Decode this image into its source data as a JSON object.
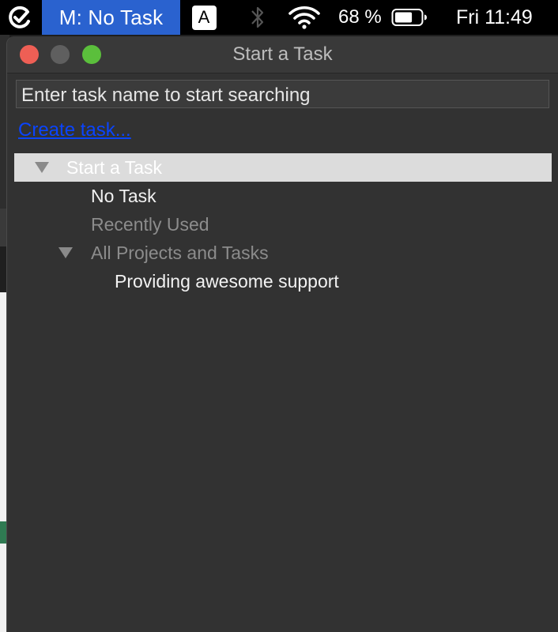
{
  "menubar": {
    "task_label": "M: No Task",
    "input_source": "A",
    "battery_percent": "68 %",
    "battery_level": 0.68,
    "clock": "Fri 11:49"
  },
  "window": {
    "title": "Start a Task",
    "search": {
      "value": "",
      "placeholder": "Enter task name to start searching"
    },
    "create_link": "Create task...",
    "tree": [
      {
        "label": "Start a Task",
        "expanded": true,
        "selected": true
      },
      {
        "label": "No Task"
      },
      {
        "label": "Recently Used"
      },
      {
        "label": "All Projects and Tasks",
        "expanded": true
      },
      {
        "label": "Providing awesome support"
      }
    ]
  },
  "colors": {
    "menubar_highlight": "#2a62cf",
    "link": "#0a44ff",
    "selection": "#dcdcdc",
    "close": "#ee5f55",
    "zoom": "#5bbf3c"
  },
  "icons": [
    "app-check-icon",
    "bluetooth-icon",
    "wifi-icon",
    "battery-icon",
    "disclosure-triangle-icon"
  ]
}
